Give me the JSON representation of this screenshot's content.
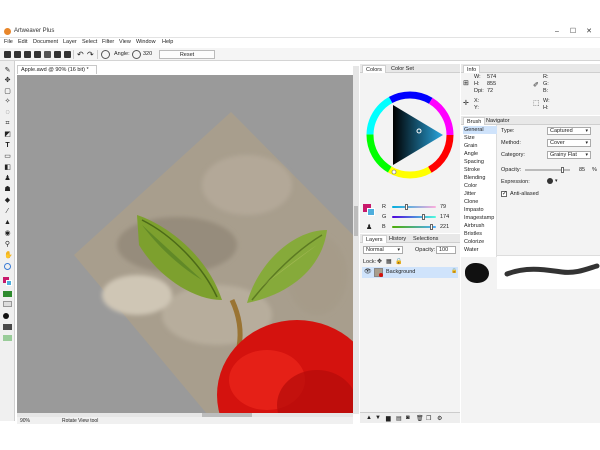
{
  "window": {
    "title": "Artweaver Plus",
    "controls": [
      "–",
      "☐",
      "✕"
    ]
  },
  "menu": [
    "File",
    "Edit",
    "Document",
    "Layer",
    "Select",
    "Filter",
    "View",
    "Window",
    "Help"
  ],
  "toolbar": {
    "angle_label": "Angle:",
    "angle_value": "320",
    "reset_label": "Reset"
  },
  "document": {
    "tab_label": "Apple.awd @ 90% (16 bit) *",
    "zoom": "90%",
    "tool_name": "Rotate View tool"
  },
  "colors_panel": {
    "tabs": [
      "Colors",
      "Color Set"
    ],
    "sliders": [
      {
        "label": "R",
        "value": "79"
      },
      {
        "label": "G",
        "value": "174"
      },
      {
        "label": "B",
        "value": "221"
      }
    ],
    "foreground": "#4faedd",
    "background": "#c8196b"
  },
  "info_panel": {
    "tab": "Info",
    "w_label": "W:",
    "w": "574",
    "h_label": "H:",
    "h": "855",
    "dpi_label": "Dpi:",
    "dpi": "72",
    "x_label": "X:",
    "y_label": "Y:",
    "r_label": "R:",
    "g_label": "G:",
    "b_label": "B:",
    "w2_label": "W:",
    "h2_label": "H:"
  },
  "brush_panel": {
    "tabs": [
      "Brush",
      "Navigator"
    ],
    "categories": [
      "General",
      "Size",
      "Grain",
      "Angle",
      "Spacing",
      "Stroke",
      "Blending",
      "Color",
      "Jitter",
      "Clone",
      "Impasto",
      "Imagestamp",
      "Airbrush",
      "Bristles",
      "Colorize",
      "Water"
    ],
    "type_label": "Type:",
    "type_value": "Captured",
    "method_label": "Method:",
    "method_value": "Cover",
    "category_label": "Category:",
    "category_value": "Grainy Flat",
    "opacity_label": "Opacity:",
    "opacity_value": "85",
    "opacity_unit": "%",
    "expression_label": "Expression:",
    "antialiased_label": "Anti-aliased"
  },
  "layers_panel": {
    "tabs": [
      "Layers",
      "History",
      "Selections"
    ],
    "blend_mode": "Normal",
    "opacity_label": "Opacity:",
    "opacity_value": "100",
    "lock_label": "Lock:",
    "layers": [
      {
        "name": "Background"
      }
    ]
  }
}
